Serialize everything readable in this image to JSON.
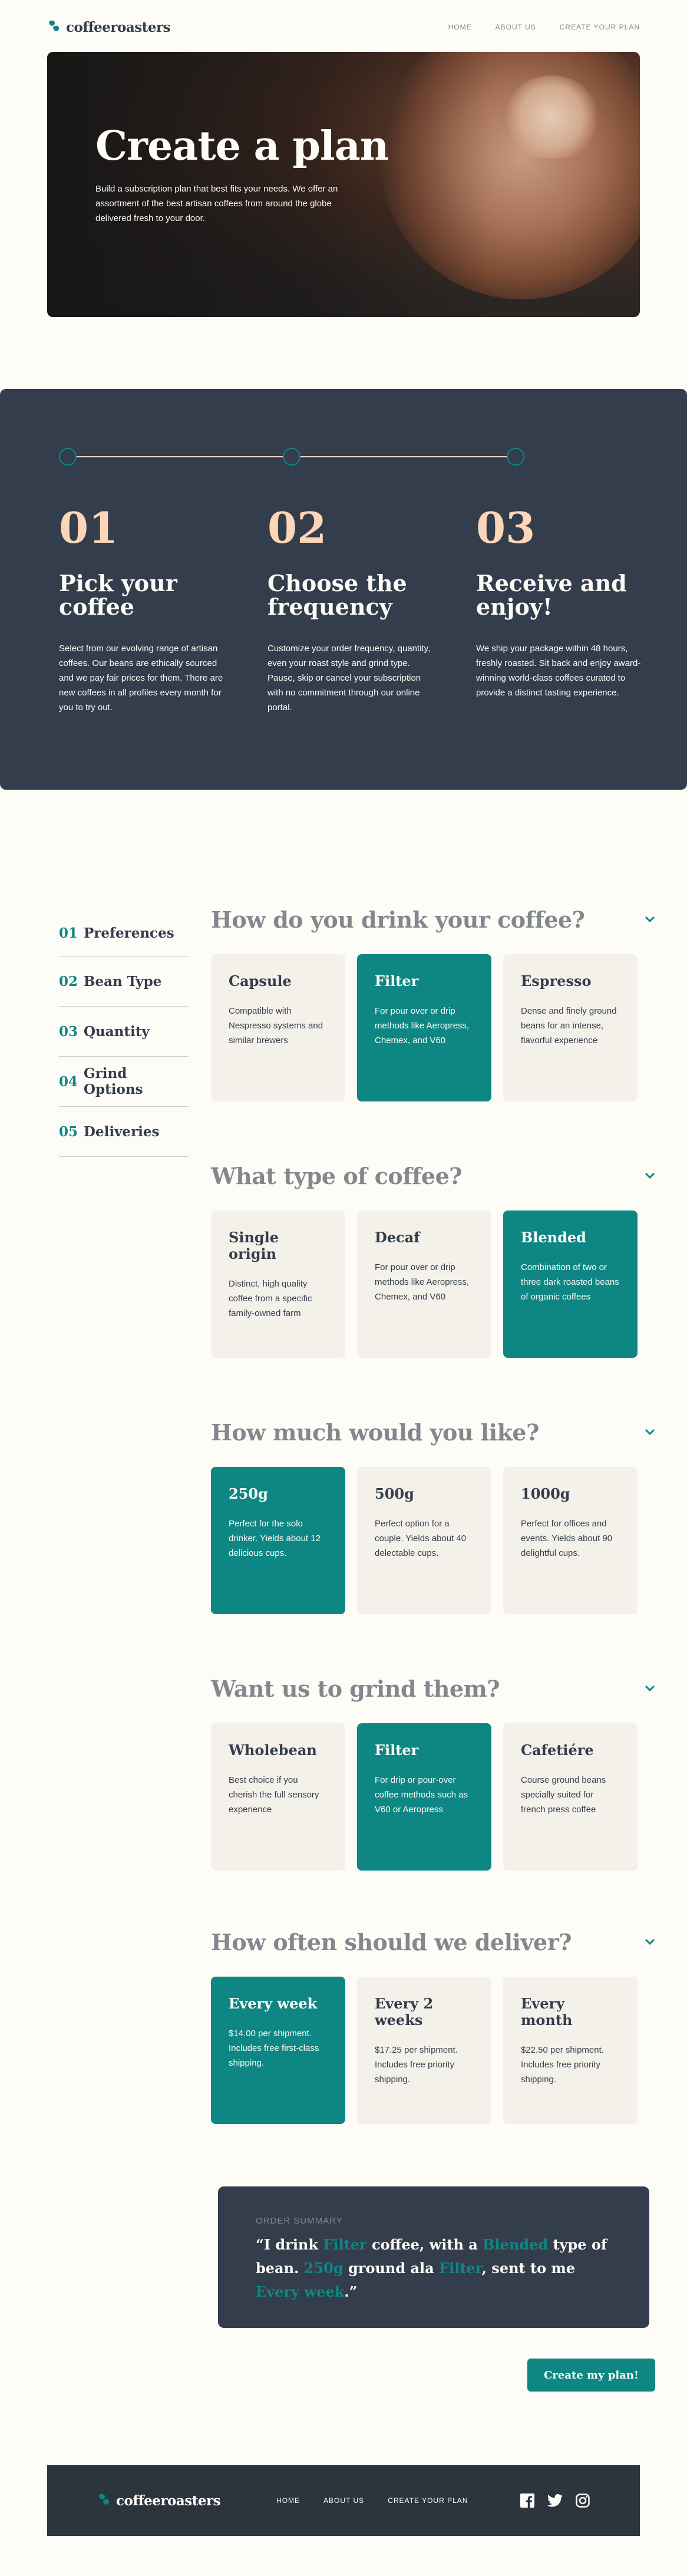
{
  "header": {
    "brand": "coffeeroasters",
    "nav": [
      "HOME",
      "ABOUT US",
      "CREATE YOUR PLAN"
    ]
  },
  "hero": {
    "title": "Create a plan",
    "text": "Build a subscription plan that best fits your needs. We offer an assortment of the best  artisan coffees from around the globe delivered fresh to your door."
  },
  "how": {
    "steps": [
      {
        "num": "01",
        "title": "Pick your coffee",
        "text": "Select from our evolving range of artisan coffees. Our beans are ethically sourced and we pay fair prices for them. There are new coffees in all profiles every month for you to try out."
      },
      {
        "num": "02",
        "title": "Choose the frequency",
        "text": "Customize your order frequency, quantity, even your roast style and grind type. Pause, skip or cancel your subscription with no commitment through our online portal."
      },
      {
        "num": "03",
        "title": "Receive and enjoy!",
        "text": "We ship your package within 48 hours, freshly roasted. Sit back and enjoy award-winning world-class coffees curated to provide a distinct tasting experience."
      }
    ]
  },
  "sidebar": {
    "items": [
      {
        "num": "01",
        "label": "Preferences"
      },
      {
        "num": "02",
        "label": "Bean Type"
      },
      {
        "num": "03",
        "label": "Quantity"
      },
      {
        "num": "04",
        "label": "Grind Options"
      },
      {
        "num": "05",
        "label": "Deliveries"
      }
    ]
  },
  "questions": [
    {
      "title": "How do you drink your coffee?",
      "options": [
        {
          "title": "Capsule",
          "text": "Compatible with Nespresso systems and similar brewers",
          "selected": false
        },
        {
          "title": "Filter",
          "text": "For pour over or drip methods like Aeropress, Chemex, and V60",
          "selected": true
        },
        {
          "title": "Espresso",
          "text": "Dense and finely ground beans for an intense, flavorful experience",
          "selected": false
        }
      ]
    },
    {
      "title": "What type of coffee?",
      "options": [
        {
          "title": "Single origin",
          "text": "Distinct, high quality coffee from a specific family-owned farm",
          "selected": false
        },
        {
          "title": "Decaf",
          "text": "For pour over or drip methods like Aeropress, Chemex, and V60",
          "selected": false
        },
        {
          "title": "Blended",
          "text": "Combination of two or three dark roasted beans of organic coffees",
          "selected": true
        }
      ]
    },
    {
      "title": "How much would you like?",
      "options": [
        {
          "title": "250g",
          "text": "Perfect for the solo drinker. Yields about 12 delicious cups.",
          "selected": true
        },
        {
          "title": "500g",
          "text": "Perfect option for a couple. Yields about 40 delectable cups.",
          "selected": false
        },
        {
          "title": "1000g",
          "text": "Perfect for offices and events. Yields about 90 delightful cups.",
          "selected": false
        }
      ]
    },
    {
      "title": "Want us to grind them?",
      "options": [
        {
          "title": "Wholebean",
          "text": "Best choice if you cherish the full sensory experience",
          "selected": false
        },
        {
          "title": "Filter",
          "text": "For drip or pour-over coffee methods such as V60 or Aeropress",
          "selected": true
        },
        {
          "title": "Cafetiére",
          "text": "Course ground beans specially suited for french press coffee",
          "selected": false
        }
      ]
    },
    {
      "title": "How often should we deliver?",
      "options": [
        {
          "title": "Every week",
          "text": "$14.00 per shipment. Includes free first-class shipping.",
          "selected": true
        },
        {
          "title": "Every 2 weeks",
          "text": "$17.25 per shipment. Includes free priority shipping.",
          "selected": false
        },
        {
          "title": "Every month",
          "text": "$22.50 per shipment. Includes free priority shipping.",
          "selected": false
        }
      ]
    }
  ],
  "summary": {
    "label": "ORDER SUMMARY",
    "p1": "“I drink ",
    "drink": "Filter",
    "p2": " coffee, with a ",
    "type": "Blended",
    "p3": " type of bean. ",
    "qty": "250g",
    "p4": " ground ala ",
    "grind": "Filter",
    "p5": ", sent to me ",
    "freq": "Every week",
    "p6": ".”"
  },
  "cta": {
    "label": "Create my plan!"
  },
  "footer": {
    "brand": "coffeeroasters",
    "nav": [
      "HOME",
      "ABOUT US",
      "CREATE YOUR PLAN"
    ],
    "socials": [
      "facebook-icon",
      "twitter-icon",
      "instagram-icon"
    ]
  },
  "colors": {
    "accent": "#0E8784",
    "dark": "#333D4B",
    "peach": "#FDD6BA",
    "grey": "#83888F",
    "cream": "#FEFCF7",
    "card": "#F4F1EB"
  }
}
